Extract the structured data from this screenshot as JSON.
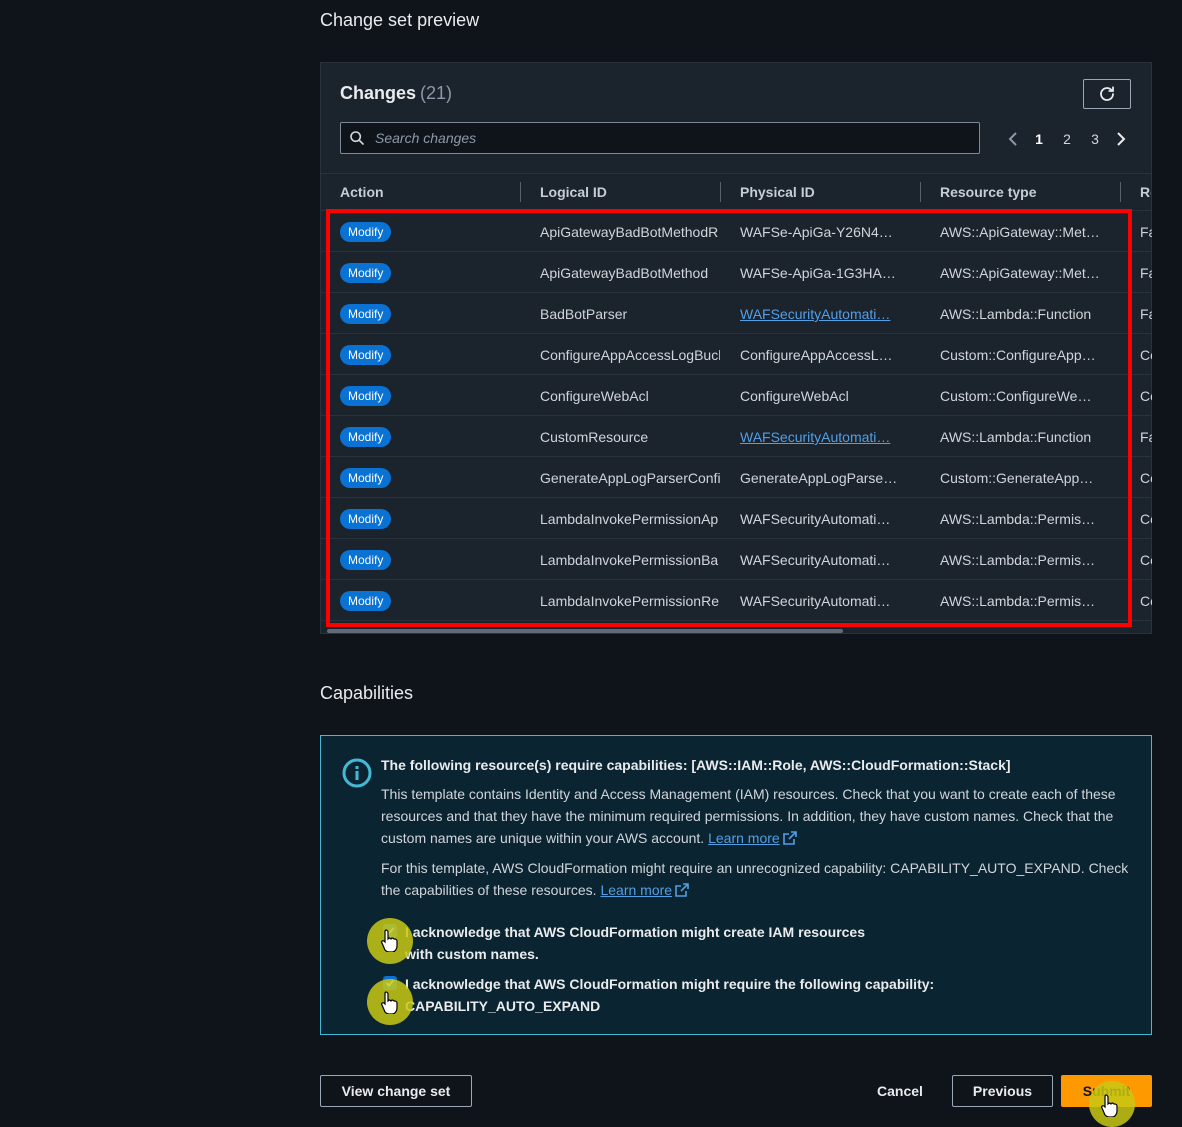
{
  "change_set": {
    "section_title": "Change set preview",
    "header_label": "Changes",
    "count": "(21)",
    "search_placeholder": "Search changes",
    "pages": [
      "1",
      "2",
      "3"
    ],
    "current_page": "1",
    "columns": [
      "Action",
      "Logical ID",
      "Physical ID",
      "Resource type",
      "Re"
    ],
    "rows": [
      {
        "action": "Modify",
        "logical_id": "ApiGatewayBadBotMethodR",
        "physical_id": "WAFSe-ApiGa-Y26N49…",
        "physical_link": false,
        "resource_type": "AWS::ApiGateway::Met…",
        "r": "Fa"
      },
      {
        "action": "Modify",
        "logical_id": "ApiGatewayBadBotMethod",
        "physical_id": "WAFSe-ApiGa-1G3HA…",
        "physical_link": false,
        "resource_type": "AWS::ApiGateway::Met…",
        "r": "Fa"
      },
      {
        "action": "Modify",
        "logical_id": "BadBotParser",
        "physical_id": "WAFSecurityAutomati…",
        "physical_link": true,
        "resource_type": "AWS::Lambda::Function",
        "r": "Fa"
      },
      {
        "action": "Modify",
        "logical_id": "ConfigureAppAccessLogBuck",
        "physical_id": "ConfigureAppAccessLo…",
        "physical_link": false,
        "resource_type": "Custom::ConfigureApp…",
        "r": "Co"
      },
      {
        "action": "Modify",
        "logical_id": "ConfigureWebAcl",
        "physical_id": "ConfigureWebAcl",
        "physical_link": false,
        "resource_type": "Custom::ConfigureWe…",
        "r": "Co"
      },
      {
        "action": "Modify",
        "logical_id": "CustomResource",
        "physical_id": "WAFSecurityAutomati…",
        "physical_link": true,
        "resource_type": "AWS::Lambda::Function",
        "r": "Fa"
      },
      {
        "action": "Modify",
        "logical_id": "GenerateAppLogParserConfi",
        "physical_id": "GenerateAppLogParse…",
        "physical_link": false,
        "resource_type": "Custom::GenerateApp…",
        "r": "Co"
      },
      {
        "action": "Modify",
        "logical_id": "LambdaInvokePermissionAp",
        "physical_id": "WAFSecurityAutomati…",
        "physical_link": false,
        "resource_type": "AWS::Lambda::Permiss…",
        "r": "Co"
      },
      {
        "action": "Modify",
        "logical_id": "LambdaInvokePermissionBa",
        "physical_id": "WAFSecurityAutomati…",
        "physical_link": false,
        "resource_type": "AWS::Lambda::Permiss…",
        "r": "Co"
      },
      {
        "action": "Modify",
        "logical_id": "LambdaInvokePermissionRe",
        "physical_id": "WAFSecurityAutomati…",
        "physical_link": false,
        "resource_type": "AWS::Lambda::Permiss…",
        "r": "Co"
      }
    ]
  },
  "capabilities": {
    "section_title": "Capabilities",
    "alert_title": "The following resource(s) require capabilities: [AWS::IAM::Role, AWS::CloudFormation::Stack]",
    "p1_text": "This template contains Identity and Access Management (IAM) resources. Check that you want to create each of these resources and that they have the minimum required permissions. In addition, they have custom names. Check that the custom names are unique within your AWS account.",
    "p2_text": "For this template, AWS CloudFormation might require an unrecognized capability: CAPABILITY_AUTO_EXPAND. Check the capabilities of these resources.",
    "learn_more": "Learn more",
    "ack1": "I acknowledge that AWS CloudFormation might create IAM resources with custom names.",
    "ack2_line1": "I acknowledge that AWS CloudFormation might require the following capability:",
    "ack2_line2": "CAPABILITY_AUTO_EXPAND",
    "ack1_checked": true,
    "ack2_checked": true
  },
  "footer": {
    "view_change_set": "View change set",
    "cancel": "Cancel",
    "previous": "Previous",
    "submit": "Submit"
  },
  "colors": {
    "background": "#0f141a",
    "panel": "#1b232d",
    "badge": "#0972d3",
    "link": "#539fe5",
    "primary": "#ff9900",
    "highlight": "#ff0000"
  },
  "icons": [
    "refresh-icon",
    "search-icon",
    "chevron-left-icon",
    "chevron-right-icon",
    "info-icon",
    "external-link-icon",
    "hand-cursor-icon"
  ]
}
